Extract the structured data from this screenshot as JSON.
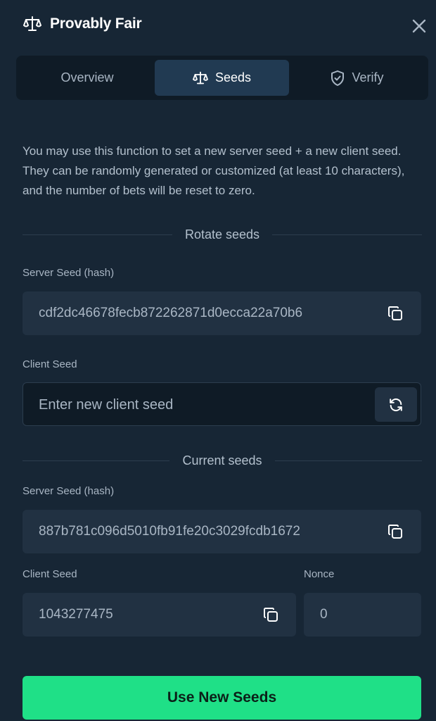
{
  "header": {
    "title": "Provably Fair",
    "icon": "scale-icon"
  },
  "tabs": [
    {
      "label": "Overview",
      "icon": "",
      "active": false
    },
    {
      "label": "Seeds",
      "icon": "scale-icon",
      "active": true
    },
    {
      "label": "Verify",
      "icon": "shield-check-icon",
      "active": false
    }
  ],
  "description": "You may use this function to set a new server seed + a new client seed. They can be randomly generated or customized (at least 10 characters), and the number of bets will be reset to zero.",
  "rotate": {
    "heading": "Rotate seeds",
    "server_seed_label": "Server Seed (hash)",
    "server_seed_value": "cdf2dc46678fecb872262871d0ecca22a70b6",
    "client_seed_label": "Client Seed",
    "client_seed_placeholder": "Enter new client seed"
  },
  "current": {
    "heading": "Current seeds",
    "server_seed_label": "Server Seed (hash)",
    "server_seed_value": "887b781c096d5010fb91fe20c3029fcdb1672",
    "client_seed_label": "Client Seed",
    "client_seed_value": "1043277475",
    "nonce_label": "Nonce",
    "nonce_value": "0"
  },
  "submit_label": "Use New Seeds",
  "colors": {
    "panel_bg": "#172635",
    "tab_bar_bg": "#0f1b26",
    "tab_active_bg": "#213a52",
    "field_bg": "#213142",
    "accent_green": "#1fe087",
    "muted_text": "#a9b6c4"
  }
}
